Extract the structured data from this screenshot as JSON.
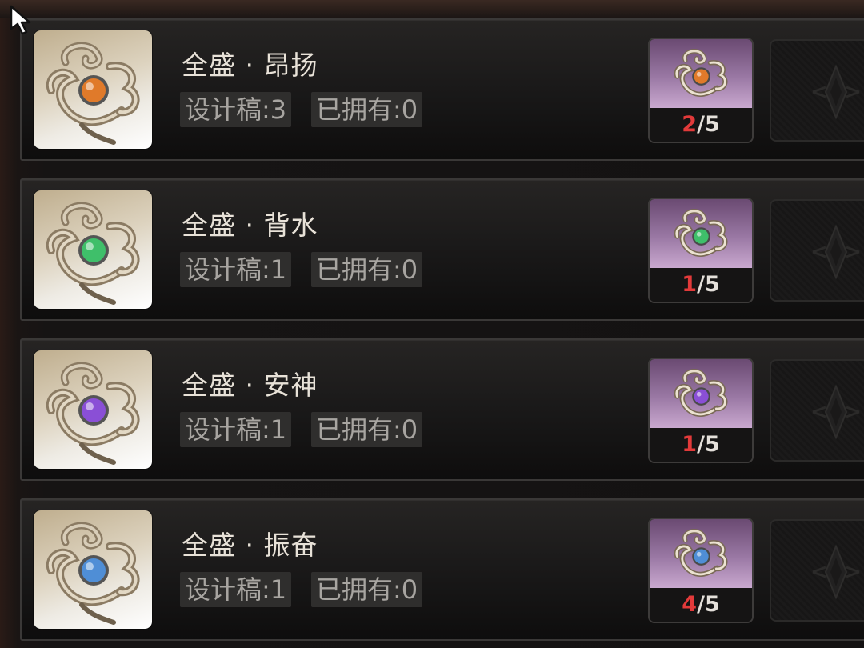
{
  "cursor": {
    "icon": "cursor-arrow-icon"
  },
  "items": [
    {
      "name": "全盛 · 昂扬",
      "draft_text": "设计稿:3",
      "owned_text": "已拥有:0",
      "gem_color": "#e07a2a",
      "gem_icon": "orange-gem-brooch-icon",
      "material_have": "2",
      "material_sep": "/",
      "material_need": "5"
    },
    {
      "name": "全盛 · 背水",
      "draft_text": "设计稿:1",
      "owned_text": "已拥有:0",
      "gem_color": "#3fbf6a",
      "gem_icon": "green-gem-brooch-icon",
      "material_have": "1",
      "material_sep": "/",
      "material_need": "5"
    },
    {
      "name": "全盛 · 安神",
      "draft_text": "设计稿:1",
      "owned_text": "已拥有:0",
      "gem_color": "#8a4fd6",
      "gem_icon": "purple-gem-brooch-icon",
      "material_have": "1",
      "material_sep": "/",
      "material_need": "5"
    },
    {
      "name": "全盛 · 振奋",
      "draft_text": "设计稿:1",
      "owned_text": "已拥有:0",
      "gem_color": "#4f8ed6",
      "gem_icon": "blue-gem-brooch-icon",
      "material_have": "4",
      "material_sep": "/",
      "material_need": "5"
    }
  ],
  "colors": {
    "count_insufficient": "#e23a3a",
    "material_bg": "#9a78a4"
  }
}
